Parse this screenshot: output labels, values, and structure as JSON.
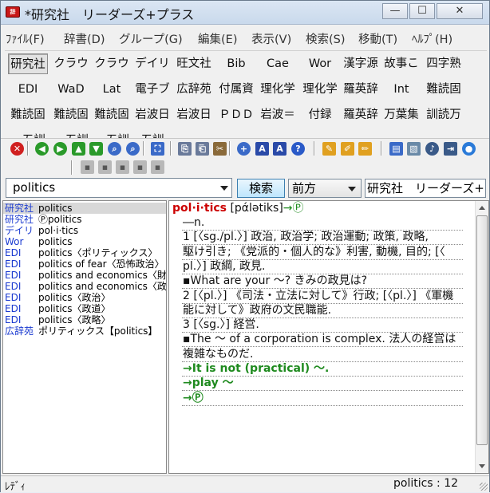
{
  "window": {
    "title": "*研究社　リーダーズ+プラス",
    "minimize": "—",
    "maximize": "☐",
    "close": "✕"
  },
  "menu": [
    "ﾌｧｲﾙ(F)",
    "辞書(D)",
    "グループ(G)",
    "編集(E)",
    "表示(V)",
    "検索(S)",
    "移動(T)",
    "ﾍﾙﾌﾟ(H)"
  ],
  "dict_rows": [
    [
      "研究社",
      "クラウ",
      "クラウ",
      "デイリ",
      "旺文社",
      "Bib",
      "Cae",
      "Wor",
      "漢字源",
      "故事こ",
      "四字熟"
    ],
    [
      "EDI",
      "WaD",
      "Lat",
      "電子ブ",
      "広辞苑",
      "付属資",
      "理化学",
      "理化学",
      "羅英辞",
      "Int",
      "難読固"
    ],
    [
      "難読固",
      "難読固",
      "難読固",
      "岩波日",
      "岩波日",
      "ＰＤＤ",
      "岩波＝",
      "付録",
      "羅英辞",
      "万葉集",
      "訓読万"
    ],
    [
      "一五訓",
      "一五訓",
      "一五訓",
      "五訓",
      "",
      "",
      "",
      "",
      "",
      "",
      ""
    ]
  ],
  "search": {
    "value": "politics",
    "button": "検索",
    "mode": "前方",
    "dictionary": "研究社　リーダーズ+プラス"
  },
  "results": [
    {
      "src": "研究社",
      "head": "politics"
    },
    {
      "src": "研究社",
      "head": "Ⓟpolitics"
    },
    {
      "src": "デイリ",
      "head": "pol·i·tics"
    },
    {
      "src": "Wor",
      "head": "politics"
    },
    {
      "src": "EDI",
      "head": "politics〈ポリティックス〉"
    },
    {
      "src": "EDI",
      "head": "politics of fear〈恐怖政治〉"
    },
    {
      "src": "EDI",
      "head": "politics and economics〈財政"
    },
    {
      "src": "EDI",
      "head": "politics and economics〈政経"
    },
    {
      "src": "EDI",
      "head": "politics〈政治〉"
    },
    {
      "src": "EDI",
      "head": "politics〈政道〉"
    },
    {
      "src": "EDI",
      "head": "politics〈政略〉"
    },
    {
      "src": "広辞苑",
      "head": "ポリティックス【politics】"
    }
  ],
  "entry": {
    "headword": "pol·i·tics",
    "pron": "[pάlətiks]",
    "headref": "→Ⓟ",
    "lines": [
      {
        "text": "―n.",
        "kind": "body"
      },
      {
        "text": "1 [〈sg./pl.〉] 政治, 政治学; 政治運動; 政策, 政略,",
        "kind": "body"
      },
      {
        "text": "駆け引き; 《党派的・個人的な》利害, 動機, 目的; [〈",
        "kind": "body"
      },
      {
        "text": "pl.〉] 政綱, 政見.",
        "kind": "body"
      },
      {
        "text": "▪What are your ～? きみの政見は?",
        "kind": "body"
      },
      {
        "text": "2 [〈pl.〉] 《司法・立法に対して》行政; [〈pl.〉] 《軍機",
        "kind": "body"
      },
      {
        "text": "能に対して》政府の文民職能.",
        "kind": "body"
      },
      {
        "text": "3 [〈sg.〉] 経営.",
        "kind": "body"
      },
      {
        "text": "▪The ～ of a corporation is complex. 法人の経営は",
        "kind": "body"
      },
      {
        "text": "複雑なものだ.",
        "kind": "body"
      },
      {
        "text": "→It is not (practical) ～.",
        "kind": "link"
      },
      {
        "text": "→play ～",
        "kind": "link"
      },
      {
        "text": "→Ⓟ",
        "kind": "link"
      }
    ]
  },
  "status": {
    "left": "ﾚﾃﾞｨ",
    "right": "politics : 12"
  },
  "colors": {
    "headword": "#cc0000",
    "link": "#1e8a1e",
    "source": "#1a3ad0",
    "selected_row": "#d8d8d8"
  }
}
